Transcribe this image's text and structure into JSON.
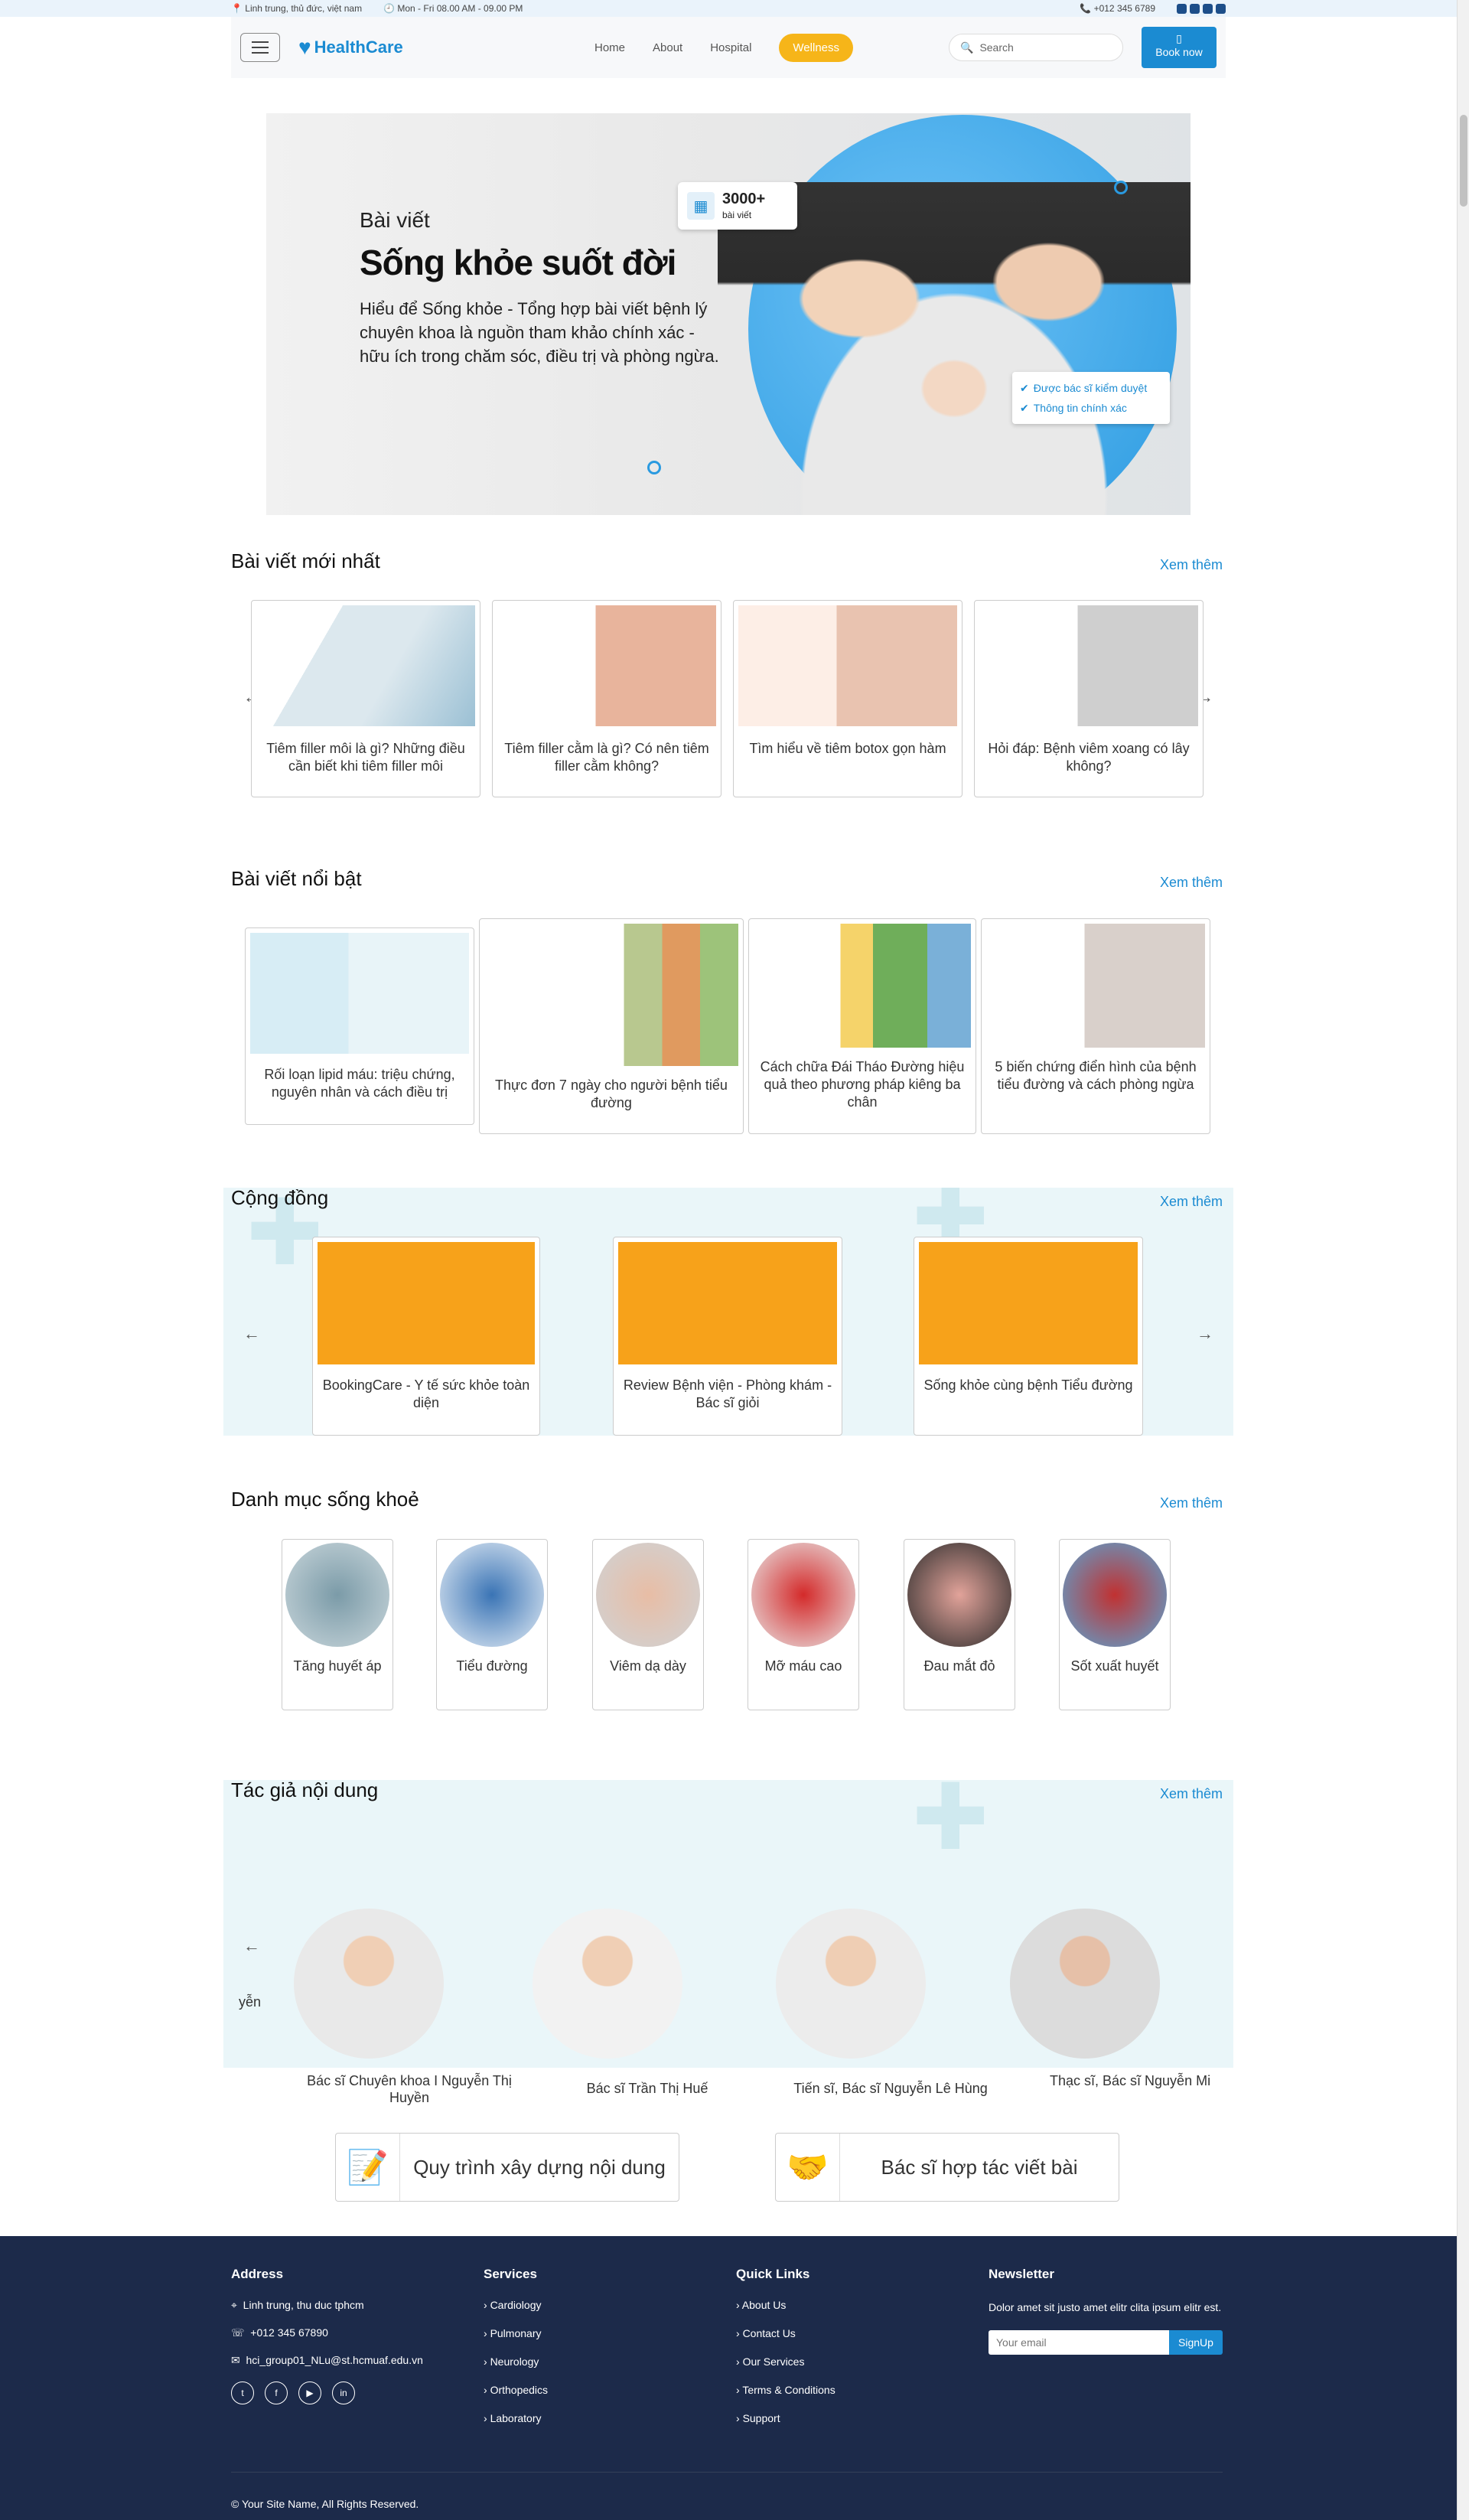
{
  "topbar": {
    "address": "Linh trung, thủ đức, việt nam",
    "hours": "Mon - Fri 08.00 AM - 09.00 PM",
    "phone": "+012 345 6789"
  },
  "nav": {
    "brand": "HealthCare",
    "home": "Home",
    "about": "About",
    "hospital": "Hospital",
    "wellness": "Wellness",
    "search_placeholder": "Search",
    "book": "Book now"
  },
  "hero": {
    "tag": "Bài viết",
    "title": "Sống khỏe suốt đời",
    "desc": "Hiểu để Sống khỏe - Tổng hợp bài viết bệnh lý chuyên khoa là nguồn tham khảo chính xác - hữu ích trong chăm sóc, điều trị và phòng ngừa.",
    "badge_count": "3000+",
    "badge_label": "bài viết",
    "check1": "Được bác sĩ kiểm duyệt",
    "check2": "Thông tin chính xác"
  },
  "latest": {
    "title": "Bài viết mới nhất",
    "more": "Xem thêm",
    "items": [
      "Tiêm filler môi là gì? Những điều cần biết khi tiêm filler môi",
      "Tiêm filler cằm là gì? Có nên tiêm filler cằm không?",
      "Tìm hiểu về tiêm botox gọn hàm",
      "Hỏi đáp: Bệnh viêm xoang có lây không?"
    ]
  },
  "featured": {
    "title": "Bài viết nổi bật",
    "more": "Xem thêm",
    "items": [
      "Rối loạn lipid máu: triệu chứng, nguyên nhân và cách điều trị",
      "Thực đơn 7 ngày cho người bệnh tiểu đường",
      "Cách chữa Đái Tháo Đường hiệu quả theo phương pháp kiêng ba chân",
      "5 biến chứng điển hình của bệnh tiểu đường và cách phòng ngừa"
    ]
  },
  "community": {
    "title": "Cộng đồng",
    "more": "Xem thêm",
    "items": [
      "BookingCare - Y tế sức khỏe toàn diện",
      "Review Bệnh viện - Phòng khám - Bác sĩ giỏi",
      "Sống khỏe cùng bệnh Tiểu đường"
    ]
  },
  "categories": {
    "title": "Danh mục sống khoẻ",
    "more": "Xem thêm",
    "items": [
      "Tăng huyết áp",
      "Tiểu đường",
      "Viêm dạ dày",
      "Mỡ máu cao",
      "Đau mắt đỏ",
      "Sốt xuất huyết"
    ]
  },
  "authors": {
    "title": "Tác giả nội dung",
    "more": "Xem thêm",
    "partial": "yễn",
    "items": [
      "Bác sĩ Chuyên khoa I Nguyễn Thị Huyền",
      "Bác sĩ Trần Thị Huế",
      "Tiến sĩ, Bác sĩ Nguyễn Lê Hùng",
      "Thạc sĩ, Bác sĩ Nguyễn Mi Quỳnh"
    ]
  },
  "cta": {
    "process": "Quy trình xây dựng nội dung",
    "cooperate": "Bác sĩ hợp tác viết bài"
  },
  "footer": {
    "address_h": "Address",
    "addr": "Linh trung, thu duc tphcm",
    "phone": "+012 345 67890",
    "email": "hci_group01_NLu@st.hcmuaf.edu.vn",
    "services_h": "Services",
    "services": [
      "Cardiology",
      "Pulmonary",
      "Neurology",
      "Orthopedics",
      "Laboratory"
    ],
    "links_h": "Quick Links",
    "links": [
      "About Us",
      "Contact Us",
      "Our Services",
      "Terms & Conditions",
      "Support"
    ],
    "news_h": "Newsletter",
    "news_text": "Dolor amet sit justo amet elitr clita ipsum elitr est.",
    "email_ph": "Your email",
    "signup": "SignUp",
    "copy": "© Your Site Name, All Rights Reserved."
  }
}
